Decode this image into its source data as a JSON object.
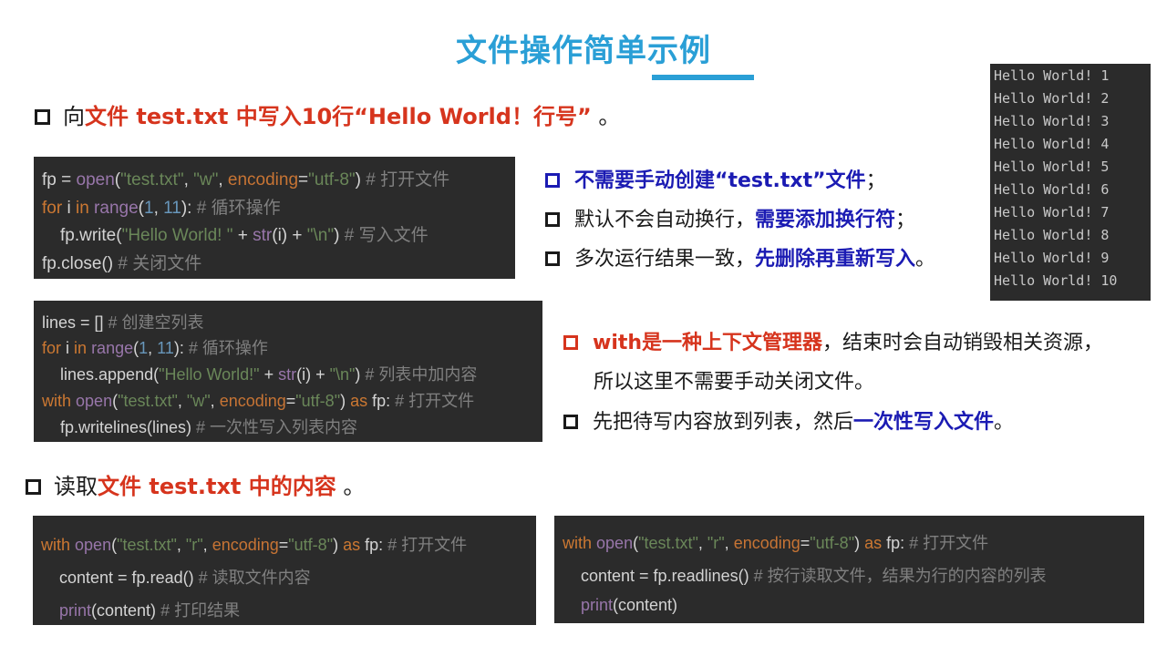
{
  "title": "文件操作简单示例",
  "bullet1": {
    "prefix": "向",
    "highlight": "文件 test.txt 中写入10行“Hello World！行号”",
    "suffix": " 。"
  },
  "code1": {
    "lines": [
      "fp = open(\"test.txt\", \"w\", encoding=\"utf-8\")  # 打开文件",
      "for i in range(1, 11):  # 循环操作",
      "fp.write(\"Hello World! \" + str(i) + \"\\n\")  # 写入文件",
      "fp.close()  # 关闭文件"
    ]
  },
  "output": {
    "lines": [
      "Hello World! 1",
      "Hello World! 2",
      "Hello World! 3",
      "Hello World! 4",
      "Hello World! 5",
      "Hello World! 6",
      "Hello World! 7",
      "Hello World! 8",
      "Hello World! 9",
      "Hello World! 10"
    ]
  },
  "notes1": {
    "item1_highlight": "不需要手动创建“test.txt”文件",
    "item1_suffix": "；",
    "item2_prefix": "默认不会自动换行，",
    "item2_highlight": "需要添加换行符",
    "item2_suffix": "；",
    "item3_prefix": "多次运行结果一致，",
    "item3_highlight": "先删除再重新写入",
    "item3_suffix": "。"
  },
  "code2": {
    "lines": [
      "lines = []  # 创建空列表",
      "for i in range(1, 11):  # 循环操作",
      "lines.append(\"Hello World!\" + str(i) + \"\\n\")  # 列表中加内容",
      "with open(\"test.txt\", \"w\", encoding=\"utf-8\") as fp:  # 打开文件",
      "fp.writelines(lines)  # 一次性写入列表内容"
    ]
  },
  "notes2": {
    "item1_highlight": "with是一种上下文管理器",
    "item1_suffix": "，结束时会自动销毁相关资源，",
    "item1_cont": "所以这里不需要手动关闭文件。",
    "item2_prefix": "先把待写内容放到列表，然后",
    "item2_highlight": "一次性写入文件",
    "item2_suffix": "。"
  },
  "bullet2": {
    "prefix": "读取",
    "highlight": "文件 test.txt 中的内容",
    "suffix": " 。"
  },
  "code3": {
    "lines": [
      "with open(\"test.txt\", \"r\", encoding=\"utf-8\") as fp:  # 打开文件",
      "content = fp.read()  # 读取文件内容",
      "print(content)  # 打印结果"
    ]
  },
  "code4": {
    "lines": [
      "with open(\"test.txt\", \"r\", encoding=\"utf-8\") as fp:  # 打开文件",
      "content = fp.readlines()  # 按行读取文件，结果为行的内容的列表",
      "print(content)"
    ]
  },
  "colors": {
    "title": "#2a9fd6",
    "highlight_red": "#d6341d",
    "highlight_blue": "#1b1bb3",
    "code_bg": "#2b2b2b"
  }
}
